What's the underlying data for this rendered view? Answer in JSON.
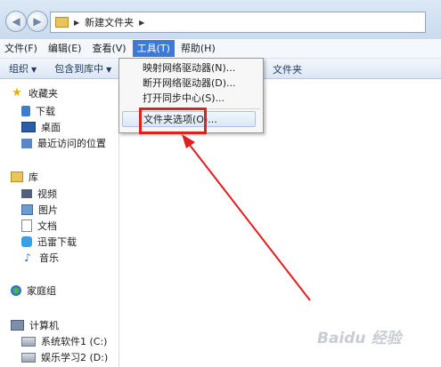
{
  "address": {
    "path": "新建文件夹",
    "back_icon": "back-arrow-icon",
    "forward_icon": "forward-arrow-icon"
  },
  "menubar": [
    {
      "label": "文件(F)"
    },
    {
      "label": "编辑(E)"
    },
    {
      "label": "查看(V)"
    },
    {
      "label": "工具(T)",
      "active": true
    },
    {
      "label": "帮助(H)"
    }
  ],
  "toolbar": {
    "organize": "组织",
    "include": "包含到库中",
    "new_folder_partial": "文件夹"
  },
  "tools_menu": {
    "items": [
      "映射网络驱动器(N)...",
      "断开网络驱动器(D)...",
      "打开同步中心(S)...",
      "文件夹选项(O)..."
    ],
    "highlighted": "文件夹选项(O)..."
  },
  "nav": {
    "favorites": {
      "header": "收藏夹",
      "items": [
        "下载",
        "桌面",
        "最近访问的位置"
      ]
    },
    "libraries": {
      "header": "库",
      "items": [
        "视频",
        "图片",
        "文档",
        "迅雷下载",
        "音乐"
      ]
    },
    "homegroup": "家庭组",
    "computer": {
      "header": "计算机",
      "items": [
        "系统软件1 (C:)",
        "娱乐学习2 (D:)"
      ]
    }
  },
  "colors": {
    "active_menu": "#3a7ad8",
    "annotation_red": "#e0201e"
  },
  "watermark": "Baidu 经验"
}
